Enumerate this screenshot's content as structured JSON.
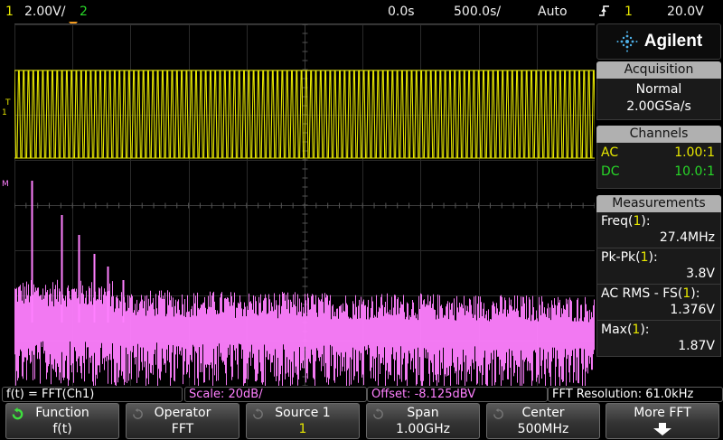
{
  "top_bar": {
    "channel1_number": "1",
    "channel1_scale": "2.00V/",
    "channel2_number": "2",
    "time_delay": "0.0s",
    "time_scale": "500.0s/",
    "trigger_mode": "Auto",
    "trigger_icon": "trigger-edge-icon",
    "trigger_source": "1",
    "trigger_level": "20.0V"
  },
  "screen": {
    "ch1_marker": "1",
    "ch1_trigger_marker": "T",
    "math_marker": "M"
  },
  "brand": {
    "logo_text": "Agilent"
  },
  "acquisition": {
    "heading": "Acquisition",
    "mode": "Normal",
    "sample_rate": "2.00GSa/s"
  },
  "channels": {
    "heading": "Channels",
    "rows": [
      {
        "coupling": "AC",
        "probe": "1.00:1",
        "color": "#e8e800"
      },
      {
        "coupling": "DC",
        "probe": "10.0:1",
        "color": "#28d828"
      }
    ]
  },
  "measurements": {
    "heading": "Measurements",
    "items": [
      {
        "label": "Freq(",
        "src": "1",
        "end": "):",
        "value": "27.4MHz"
      },
      {
        "label": "Pk-Pk(",
        "src": "1",
        "end": "):",
        "value": "3.8V"
      },
      {
        "label": "AC RMS - FS(",
        "src": "1",
        "end": "):",
        "value": "1.376V"
      },
      {
        "label": "Max(",
        "src": "1",
        "end": "):",
        "value": "1.87V"
      }
    ]
  },
  "info_bar": {
    "function": "f(t) = FFT(Ch1)",
    "scale": "Scale: 20dB/",
    "offset": "Offset: -8.125dBV",
    "resolution": "FFT Resolution: 61.0kHz"
  },
  "softkeys": [
    {
      "label": "Function",
      "value": "f(t)",
      "icon": "rotate-knob-icon-green",
      "value_color": "#ffffff"
    },
    {
      "label": "Operator",
      "value": "FFT",
      "icon": "rotate-knob-icon",
      "value_color": "#ffffff"
    },
    {
      "label": "Source 1",
      "value": "1",
      "icon": "rotate-knob-icon",
      "value_color": "#e8e800"
    },
    {
      "label": "Span",
      "value": "1.00GHz",
      "icon": "rotate-knob-icon",
      "value_color": "#ffffff"
    },
    {
      "label": "Center",
      "value": "500MHz",
      "icon": "rotate-knob-icon",
      "value_color": "#ffffff"
    },
    {
      "label": "More FFT",
      "value": "",
      "icon": "down-arrow-icon",
      "value_color": "#ffffff"
    }
  ],
  "colors": {
    "channel1": "#e8e800",
    "channel2": "#28d828",
    "math": "#ff80ff",
    "trigger_marker": "#f39a1d"
  }
}
